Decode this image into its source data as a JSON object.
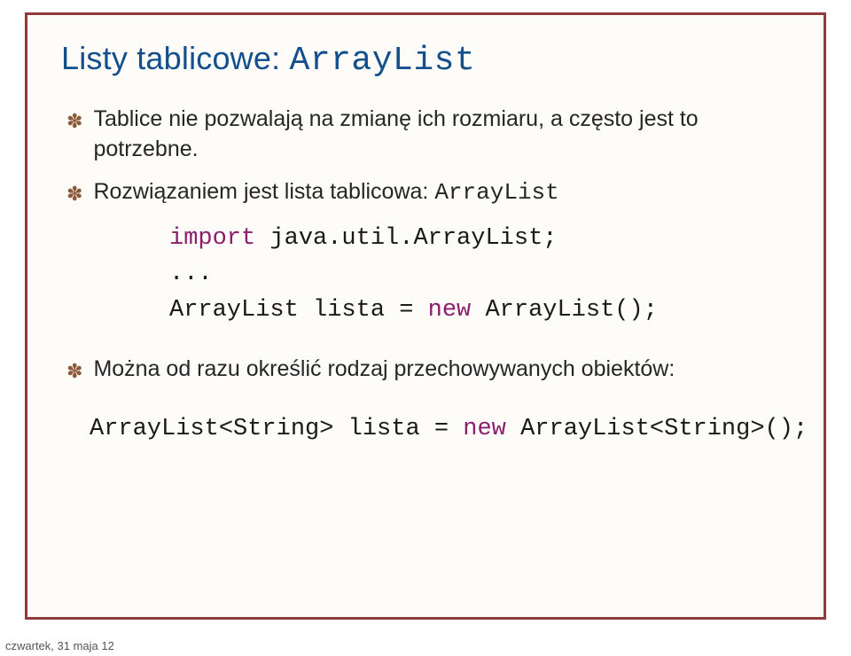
{
  "title": {
    "prefix": "Listy tablicowe: ",
    "mono": "ArrayList"
  },
  "bullets": {
    "b1": "Tablice nie pozwalają na zmianę ich rozmiaru, a często jest to potrzebne.",
    "b2_prefix": "Rozwiązaniem jest lista tablicowa: ",
    "b2_mono": "ArrayList",
    "b3": "Można od razu określić rodzaj przechowywanych obiektów:"
  },
  "code1": {
    "kw_import": "import",
    "l1_rest": " java.util.ArrayList;",
    "l2": "...",
    "l3_a": "ArrayList lista = ",
    "kw_new": "new",
    "l3_c": " ArrayList();"
  },
  "code2": {
    "a": "ArrayList<String> lista = ",
    "kw_new": "new",
    "c": " ArrayList<String>();"
  },
  "footer": "czwartek, 31 maja 12"
}
